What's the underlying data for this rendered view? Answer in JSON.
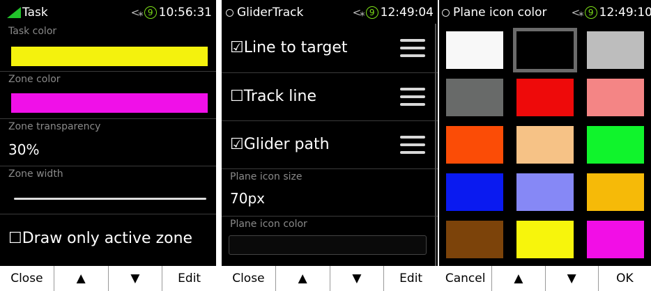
{
  "panels": {
    "task": {
      "title": "Task",
      "time": "10:56:31",
      "gps_count": "9",
      "bt_symbol": "<⁎",
      "rows": {
        "task_color": {
          "label": "Task color",
          "color": "#f4f20d"
        },
        "zone_color": {
          "label": "Zone color",
          "color": "#f010e8"
        },
        "zone_transparency": {
          "label": "Zone transparency",
          "value": "30%"
        },
        "zone_width": {
          "label": "Zone width"
        },
        "draw_only_active": {
          "label": "☐Draw only active zone"
        }
      },
      "buttons": [
        "Close",
        "▲",
        "▼",
        "Edit"
      ]
    },
    "glider_track": {
      "title": "GliderTrack",
      "time": "12:49:04",
      "gps_count": "9",
      "bt_symbol": "<⁎",
      "rows": {
        "line_to_target": {
          "label": "☑Line to target"
        },
        "track_line": {
          "label": "☐Track line"
        },
        "glider_path": {
          "label": "☑Glider path"
        },
        "plane_icon_size": {
          "label": "Plane icon size",
          "value": "70px"
        },
        "plane_icon_color": {
          "label": "Plane icon color"
        }
      },
      "buttons": [
        "Close",
        "▲",
        "▼",
        "Edit"
      ]
    },
    "plane_icon_color": {
      "title": "Plane icon color",
      "time": "12:49:10",
      "gps_count": "9",
      "bt_symbol": "<⁎",
      "colors": [
        "#f8f8f8",
        "#000000",
        "#bdbdbd",
        "#686a69",
        "#ee0a0a",
        "#f48585",
        "#fb4c06",
        "#f6c286",
        "#10f42c",
        "#0a1af0",
        "#8688f6",
        "#f6ba08",
        "#7c430a",
        "#f7f50c",
        "#f20ee6"
      ],
      "selected_index": 1,
      "buttons": [
        "Cancel",
        "▲",
        "▼",
        "OK"
      ]
    }
  }
}
